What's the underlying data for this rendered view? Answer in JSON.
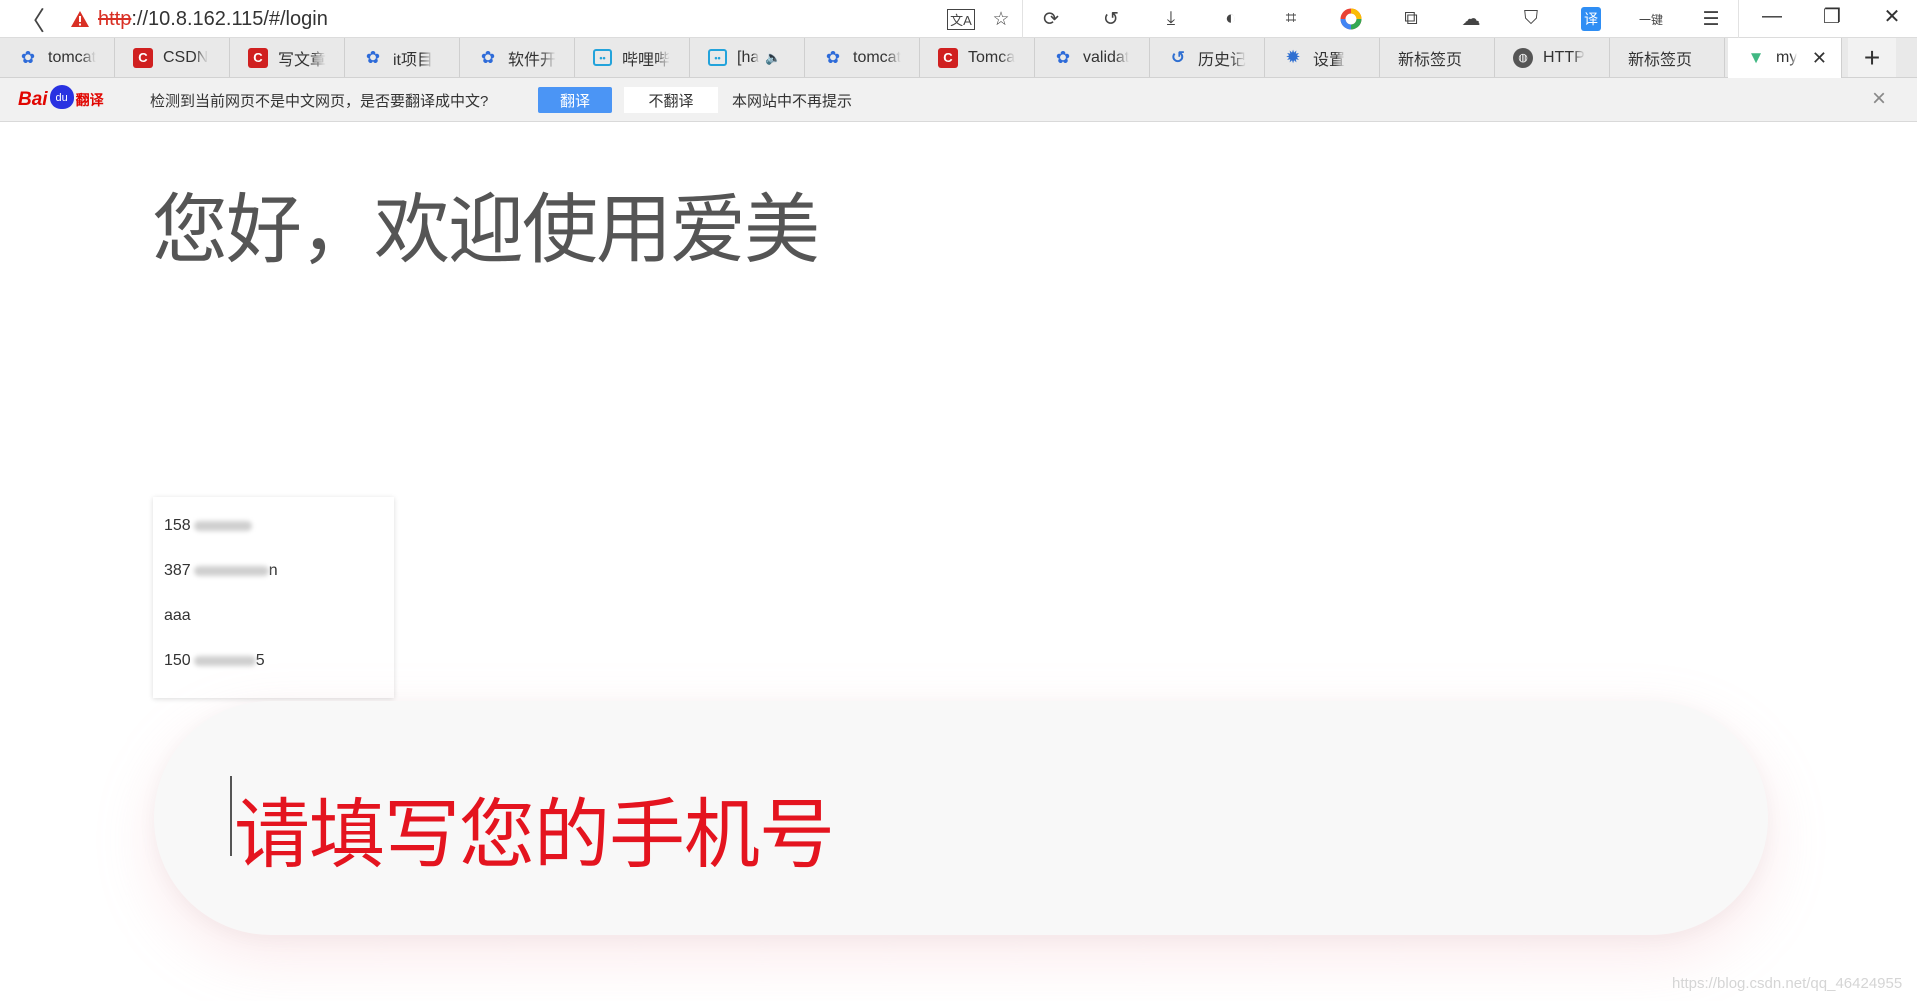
{
  "browser": {
    "url_protocol": "http",
    "url_rest": "://10.8.162.115/#/login",
    "toolbar_icons": [
      "translate-page-icon",
      "star-icon",
      "refresh-icon",
      "undo-icon",
      "download-icon",
      "night-mode-icon",
      "crop-icon",
      "color-wheel-icon",
      "link-icon",
      "cloud-icon",
      "shield-icon",
      "translate-icon",
      "one-key-icon",
      "menu-icon"
    ],
    "window_controls": {
      "minimize": "—",
      "restore": "❐",
      "close": "✕"
    },
    "tabs": [
      {
        "label": "tomcat",
        "icon": "baidu-paw-icon"
      },
      {
        "label": "CSDN",
        "icon": "csdn-icon"
      },
      {
        "label": "写文章",
        "icon": "csdn-icon"
      },
      {
        "label": "it项目",
        "icon": "baidu-paw-icon"
      },
      {
        "label": "软件开",
        "icon": "baidu-paw-icon"
      },
      {
        "label": "哔哩哔",
        "icon": "bilibili-icon"
      },
      {
        "label": "[ha",
        "icon": "bilibili-icon"
      },
      {
        "label": "tomcat",
        "icon": "baidu-paw-icon"
      },
      {
        "label": "Tomca",
        "icon": "csdn-icon"
      },
      {
        "label": "validat",
        "icon": "baidu-paw-icon"
      },
      {
        "label": "历史记",
        "icon": "history-icon"
      },
      {
        "label": "设置",
        "icon": "gear-icon"
      },
      {
        "label": "新标签页",
        "icon": ""
      },
      {
        "label": "HTTP",
        "icon": "globe-icon"
      },
      {
        "label": "新标签页",
        "icon": ""
      },
      {
        "label": "my",
        "icon": "vue-icon",
        "active": true
      }
    ],
    "new_tab": "+"
  },
  "translate_bar": {
    "logo_bai": "Bai",
    "logo_du": "du",
    "logo_fanyi": "翻译",
    "message": "检测到当前网页不是中文网页，是否要翻译成中文?",
    "translate_button": "翻译",
    "no_translate_button": "不翻译",
    "never_link": "本网站中不再提示",
    "close": "×"
  },
  "page": {
    "greeting": "您好，欢迎使用爱美",
    "autocomplete": [
      {
        "visible": "158",
        "hidden": "xxxxxx"
      },
      {
        "visible": "387",
        "hidden": "xxxxxxxxxxx",
        "suffix": "n"
      },
      {
        "visible": "aaa",
        "hidden": ""
      },
      {
        "visible": "150",
        "hidden": "xxxxxxx",
        "suffix": "5"
      }
    ],
    "phone_placeholder": "请填写您的手机号",
    "accent_color": "#e4141f"
  },
  "watermark": "https://blog.csdn.net/qq_46424955"
}
